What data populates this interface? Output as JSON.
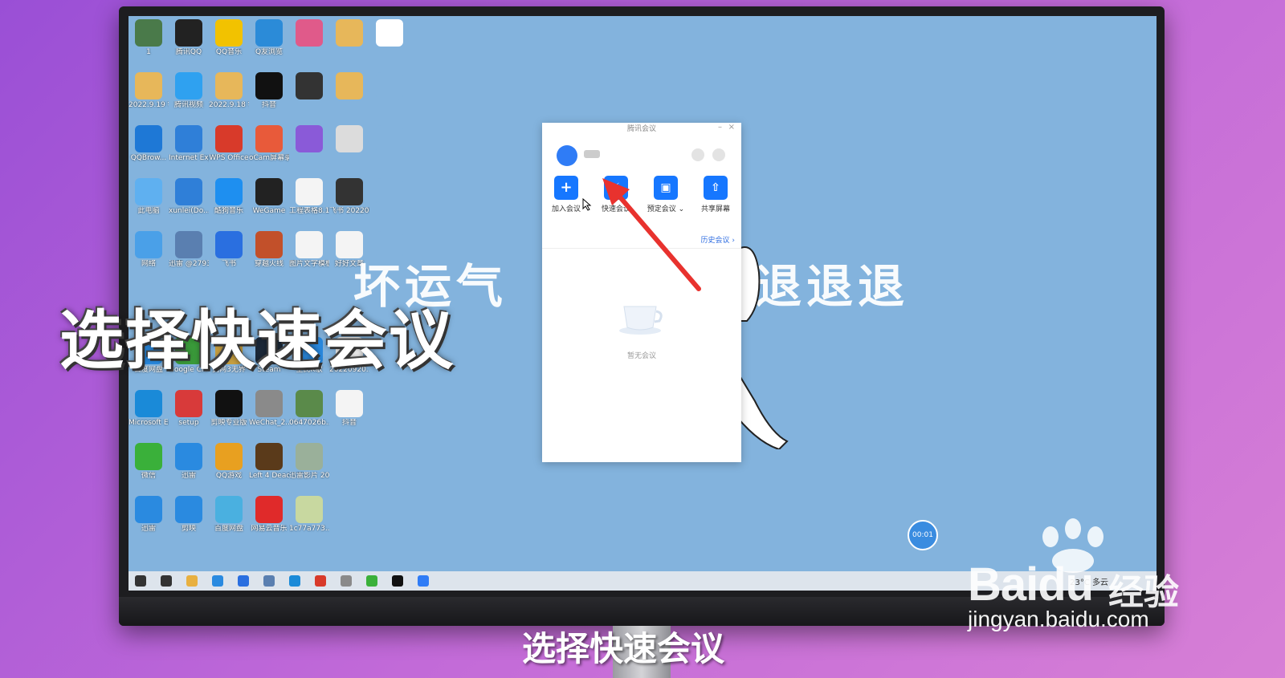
{
  "desktop": {
    "icons": [
      {
        "label": "1",
        "color": "#4a7a4a"
      },
      {
        "label": "腾讯QQ",
        "color": "#222"
      },
      {
        "label": "QQ音乐",
        "color": "#f2c200"
      },
      {
        "label": "Q友浏览",
        "color": "#2b8bd8"
      },
      {
        "label": "",
        "color": "#e05a8a"
      },
      {
        "label": "",
        "color": "#e7b75a"
      },
      {
        "label": "",
        "color": "#ffffff"
      },
      {
        "label": "2022.9.19 学习…",
        "color": "#e7b75a"
      },
      {
        "label": "腾讯视频",
        "color": "#2fa1f0"
      },
      {
        "label": "2022.9.18 学习…",
        "color": "#e7b75a"
      },
      {
        "label": "抖音",
        "color": "#111"
      },
      {
        "label": "",
        "color": "#333"
      },
      {
        "label": "",
        "color": "#e7b75a"
      },
      {
        "label": "",
        "color": "#83b3dd"
      },
      {
        "label": "QQBrow...",
        "color": "#1e78d6"
      },
      {
        "label": "Internet Explorer",
        "color": "#2f7fd8"
      },
      {
        "label": "WPS Office",
        "color": "#d83a2a"
      },
      {
        "label": "oCam屏幕录像",
        "color": "#e85a3a"
      },
      {
        "label": "",
        "color": "#8a5ad8"
      },
      {
        "label": "",
        "color": "#dcdcdc"
      },
      {
        "label": "",
        "color": "#83b3dd"
      },
      {
        "label": "此电脑",
        "color": "#5fb0f0"
      },
      {
        "label": "xunlei(Do...",
        "color": "#2f7fd8"
      },
      {
        "label": "酷狗音乐",
        "color": "#1e8ff0"
      },
      {
        "label": "WeGame",
        "color": "#222"
      },
      {
        "label": "工程表格8.15",
        "color": "#f4f4f4"
      },
      {
        "label": "飞书 20220920...",
        "color": "#333"
      },
      {
        "label": "",
        "color": "#83b3dd"
      },
      {
        "label": "网络",
        "color": "#4aa0e8"
      },
      {
        "label": "迅雷 @279384...",
        "color": "#5a7fb0"
      },
      {
        "label": "飞书",
        "color": "#2a6fe0"
      },
      {
        "label": "穿越火线",
        "color": "#c2502a"
      },
      {
        "label": "图片文字模板",
        "color": "#f4f4f4"
      },
      {
        "label": "好好文章",
        "color": "#f4f4f4"
      },
      {
        "label": "",
        "color": "#83b3dd"
      }
    ],
    "icons_lower": [
      {
        "label": "百度网盘",
        "color": "#2a8ae0"
      },
      {
        "label": "Google Chrome",
        "color": "#3a9a3a"
      },
      {
        "label": "剑网3无界",
        "color": "#c8a040"
      },
      {
        "label": "Steam",
        "color": "#1b2838"
      },
      {
        "label": "全民K歌",
        "color": "#2a8ae0"
      },
      {
        "label": "20220920...",
        "color": "#f4f4f4"
      },
      {
        "label": "Microsoft Edge",
        "color": "#1a8ad8"
      },
      {
        "label": "setup",
        "color": "#d83a3a"
      },
      {
        "label": "剪映专业版",
        "color": "#111"
      },
      {
        "label": "WeChat_2...",
        "color": "#8a8a8a"
      },
      {
        "label": "0647026b...",
        "color": "#5a8a4a"
      },
      {
        "label": "抖音",
        "color": "#f4f4f4"
      },
      {
        "label": "微信",
        "color": "#3ab03a"
      },
      {
        "label": "迅雷",
        "color": "#2a8ae0"
      },
      {
        "label": "QQ游戏",
        "color": "#e8a020"
      },
      {
        "label": "Left 4 Dead 2",
        "color": "#5a3a1a"
      },
      {
        "label": "迅雷影片 2022050...",
        "color": "#9ab09a"
      },
      {
        "label": "",
        "color": "#83b3dd"
      },
      {
        "label": "迅雷",
        "color": "#2a8ae0"
      },
      {
        "label": "剪映",
        "color": "#2a8ae0"
      },
      {
        "label": "百度网盘",
        "color": "#4ab0e0"
      },
      {
        "label": "网易云音乐",
        "color": "#e02a2a"
      },
      {
        "label": "1c77a773...",
        "color": "#c8d8a0"
      }
    ],
    "bg_text_left": "坏运气",
    "bg_text_right": "退退退"
  },
  "meeting_window": {
    "title": "腾讯会议",
    "minimize": "–",
    "close": "×",
    "actions": [
      {
        "label": "加入会议",
        "icon": "plus-icon",
        "glyph": "+"
      },
      {
        "label": "快速会议",
        "icon": "lightning-icon",
        "glyph": "⚡"
      },
      {
        "label": "预定会议 ⌄",
        "icon": "calendar-icon",
        "glyph": "▣"
      },
      {
        "label": "共享屏幕",
        "icon": "share-screen-icon",
        "glyph": "⇧"
      }
    ],
    "history_link": "历史会议 ›",
    "empty_text": "暂无会议"
  },
  "taskbar": {
    "tray_text": "23°C 多云",
    "icon_colors": [
      "#333",
      "#333",
      "#e8b040",
      "#2a8ae0",
      "#2a6fe0",
      "#5a7fb0",
      "#1a8ad8",
      "#d83a2a",
      "#8a8a8a",
      "#3ab03a",
      "#111",
      "#2f7cf6"
    ]
  },
  "recorder": {
    "time": "00:01"
  },
  "overlay": {
    "title": "选择快速会议",
    "subtitle": "选择快速会议"
  },
  "watermark": {
    "logo": "Baidu",
    "jingyan": "经验",
    "url": "jingyan.baidu.com"
  }
}
